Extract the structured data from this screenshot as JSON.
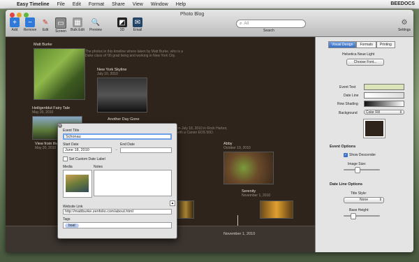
{
  "menubar": {
    "apple": "",
    "app": "Easy Timeline",
    "items": [
      "File",
      "Edit",
      "Format",
      "Share",
      "View",
      "Window",
      "Help"
    ],
    "right": "BEEDOCS"
  },
  "window": {
    "title": "Photo Blog"
  },
  "toolbar": {
    "buttons": [
      {
        "label": "Add",
        "icon": "plus-icon",
        "color": "#2f7ad8"
      },
      {
        "label": "Remove",
        "icon": "minus-icon",
        "color": "#2f7ad8"
      },
      {
        "label": "Edit",
        "icon": "pencil-icon",
        "color": "#c33"
      },
      {
        "label": "Screen",
        "icon": "screen-icon",
        "color": "#777"
      },
      {
        "label": "Bulk Edit",
        "icon": "grid-icon",
        "color": "#777"
      },
      {
        "label": "Preview",
        "icon": "magnifier-icon",
        "color": "#999"
      },
      {
        "label": "3D",
        "icon": "3d-icon",
        "color": "#333"
      },
      {
        "label": "Email",
        "icon": "email-icon",
        "color": "#246"
      },
      {
        "label": "Settings",
        "icon": "gear-icon",
        "color": "#777"
      }
    ],
    "search_placeholder": "All",
    "search_label": "Search"
  },
  "events": [
    {
      "title": "Matt Burke",
      "desc": "The photos in this timeline where taken by Matt Burke, who is a Duke class of '06 grad living and working in New York City."
    },
    {
      "title": "New York Skyline",
      "date": "July 10, 2010"
    },
    {
      "title": "Heiligenblut Fairy Tale",
      "date": "May 20, 2010"
    },
    {
      "title": "Another Day Gone",
      "desc": "on July 18, 2010 in Rock Harbor, with a Canon EOS 50D."
    },
    {
      "title": "View from the...",
      "date": "May 20, 2010"
    },
    {
      "title": "Abby",
      "date": "October 19, 2010"
    },
    {
      "title": "Serenity",
      "date": "November 1, 2010"
    }
  ],
  "timeline": {
    "date_label": "November 1, 2010"
  },
  "inspector": {
    "tabs": [
      "Visual Design",
      "Formats",
      "Printing"
    ],
    "font_name": "Helvetica Neue Light",
    "choose_font": "Choose Font...",
    "event_text": "Event Text",
    "date_line": "Date Line",
    "row_shading": "Row Shading",
    "background": "Background",
    "background_value": "Color Fill",
    "event_options": "Event Options",
    "show_descender": "Show Descender",
    "image_size": "Image Size:",
    "date_line_options": "Date Line Options",
    "title_style": "Title Style:",
    "title_style_value": "None",
    "base_height": "Base Height:"
  },
  "dialog": {
    "event_title_label": "Event Title",
    "event_title_value": "Schonau",
    "start_date_label": "Start Date",
    "start_date_value": "June 18, 2010",
    "end_date_label": "End Date",
    "end_dash": "-",
    "custom_date_label": "Set Custom Date Label",
    "media_label": "Media",
    "notes_label": "Notes",
    "website_label": "Website Link",
    "website_value": "http://mattburke.zenfolio.com/about.html",
    "tags_label": "Tags",
    "tag": "boat"
  }
}
